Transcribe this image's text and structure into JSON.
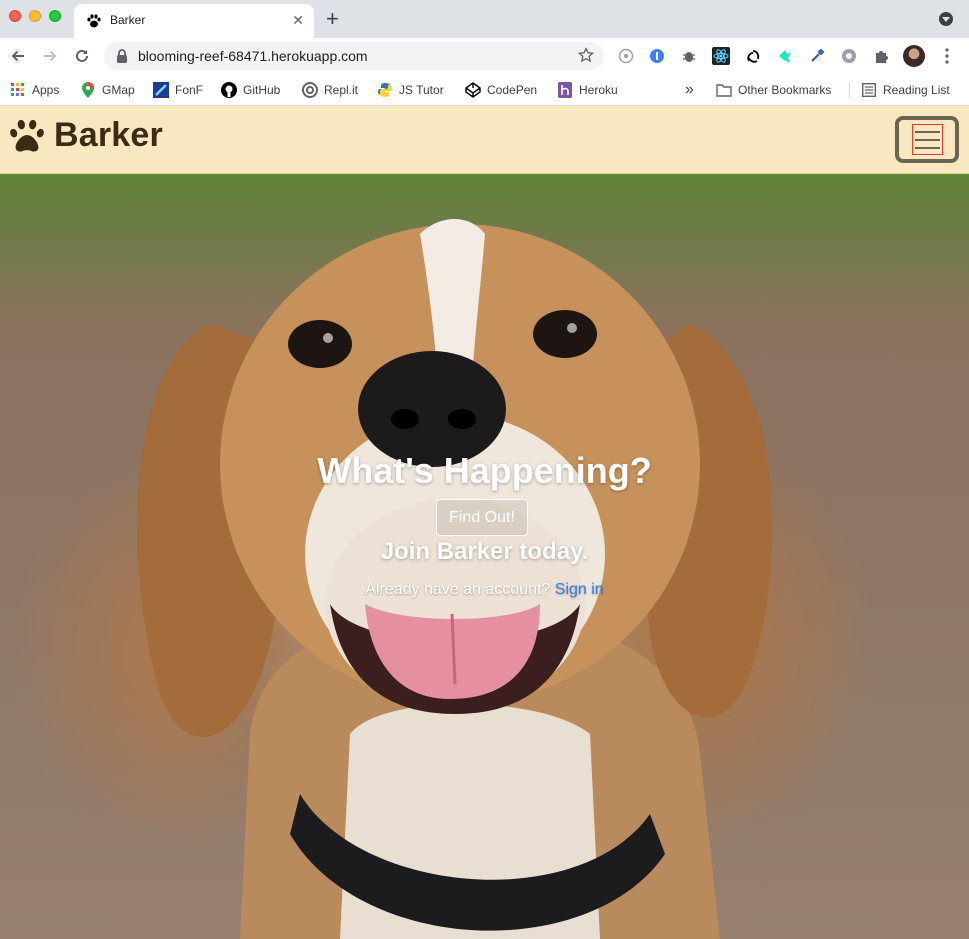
{
  "browser": {
    "tab": {
      "title": "Barker",
      "favicon": "paw-icon"
    },
    "new_tab": "+",
    "url": "blooming-reef-68471.herokuapp.com",
    "bookmarks": [
      {
        "label": "Apps",
        "icon": "apps-grid-icon"
      },
      {
        "label": "GMap",
        "icon": "map-pin-icon"
      },
      {
        "label": "FonF",
        "icon": "fonf-icon"
      },
      {
        "label": "GitHub",
        "icon": "github-icon"
      },
      {
        "label": "Repl.it",
        "icon": "replit-icon"
      },
      {
        "label": "JS Tutor",
        "icon": "python-icon"
      },
      {
        "label": "CodePen",
        "icon": "codepen-icon"
      },
      {
        "label": "Heroku",
        "icon": "heroku-icon"
      }
    ],
    "overflow": "»",
    "other_bookmarks": "Other Bookmarks",
    "reading_list": "Reading List"
  },
  "site": {
    "brand": "Barker",
    "brand_color": "#3b2a14",
    "navbar_color": "#f7e8bf"
  },
  "hero": {
    "headline": "What's Happening?",
    "cta_label": "Find Out!",
    "join_text": "Join Barker today.",
    "account_prompt": "Already have an account?",
    "signin_label": "Sign in",
    "link_color": "#2b7cf6"
  }
}
